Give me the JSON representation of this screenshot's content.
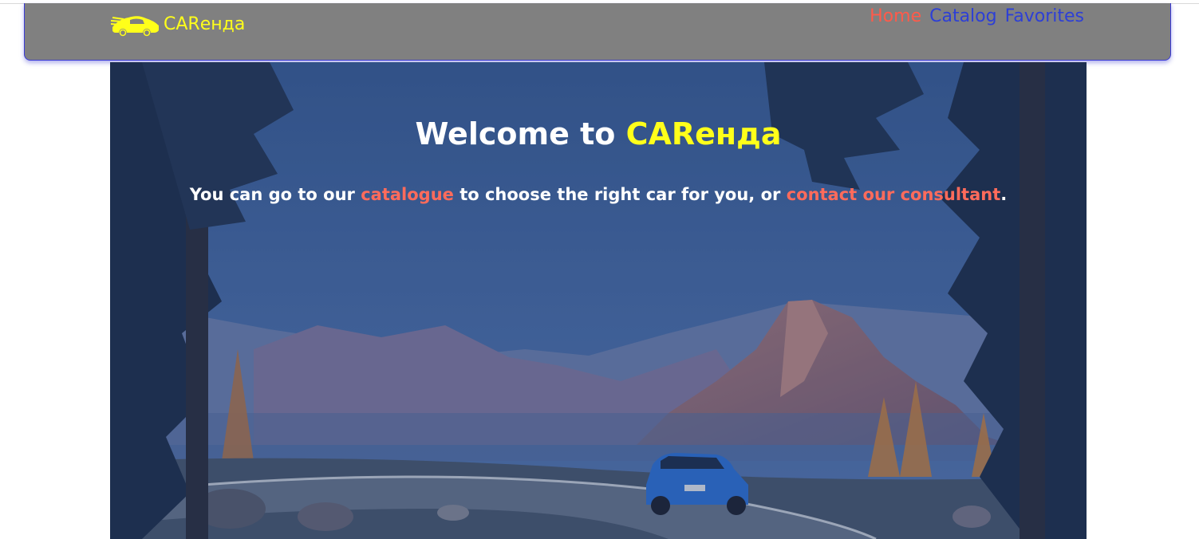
{
  "header": {
    "logo_text": "CARенда",
    "nav": [
      {
        "label": "Home",
        "color": "#ff5a4a"
      },
      {
        "label": "Catalog",
        "color": "#2d3fd6"
      },
      {
        "label": "Favorites",
        "color": "#2d3fd6"
      }
    ]
  },
  "hero": {
    "title_prefix": "Welcome to ",
    "title_brand": "CARенда",
    "sub_part1": "You can go to our ",
    "sub_link1": "catalogue",
    "sub_part2": " to choose the right car for you, or ",
    "sub_link2": "contact our consultant",
    "sub_part3": "."
  },
  "colors": {
    "header_bg": "#808080",
    "brand_yellow": "#ffff1a",
    "link_red": "#ff6b5b",
    "nav_blue": "#2d3fd6",
    "overlay_blue": "#1e3c78"
  },
  "icons": {
    "logo": "car-logo-icon"
  }
}
